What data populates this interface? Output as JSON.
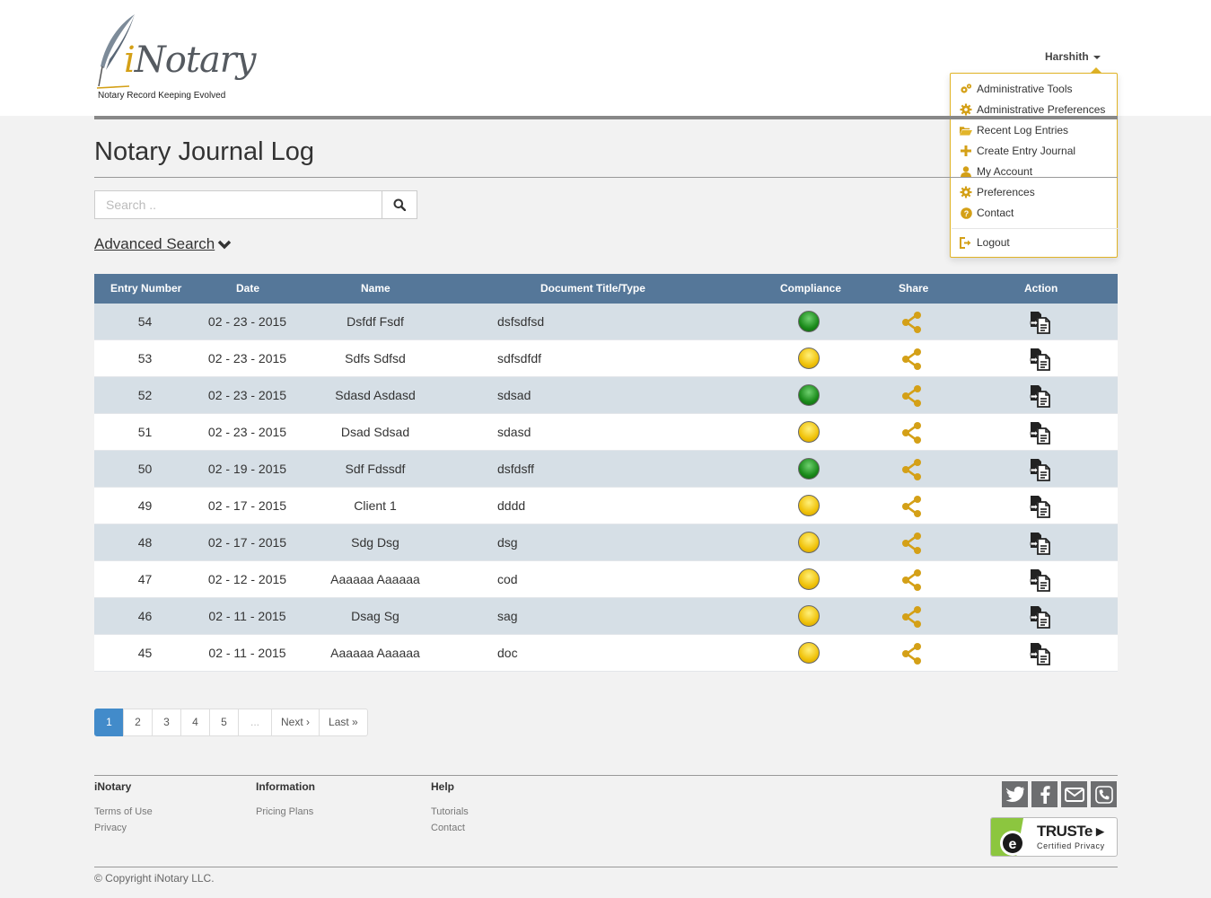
{
  "brand": {
    "name_prefix": "i",
    "name_rest": "Notary",
    "tagline": "Notary Record Keeping Evolved",
    "accent_color": "#d4a017"
  },
  "user_menu": {
    "username": "Harshith",
    "items": [
      {
        "label": "Administrative Tools",
        "icon": "cogs-icon"
      },
      {
        "label": "Administrative Preferences",
        "icon": "gear-icon"
      },
      {
        "label": "Recent Log Entries",
        "icon": "folder-open-icon"
      },
      {
        "label": "Create Entry Journal",
        "icon": "plus-icon"
      },
      {
        "label": "My Account",
        "icon": "user-icon"
      },
      {
        "label": "Preferences",
        "icon": "gear-icon"
      },
      {
        "label": "Contact",
        "icon": "question-circle-icon"
      }
    ],
    "logout_label": "Logout"
  },
  "page": {
    "title": "Notary Journal Log"
  },
  "search": {
    "placeholder": "Search ..",
    "advanced_label": "Advanced Search"
  },
  "table": {
    "header_color": "#557799",
    "columns": [
      "Entry Number",
      "Date",
      "Name",
      "Document Title/Type",
      "Compliance",
      "Share",
      "Action"
    ],
    "rows": [
      {
        "entry": "54",
        "date": "02 - 23 - 2015",
        "name": "Dsfdf Fsdf",
        "doc": "dsfsdfsd",
        "compliance": "green"
      },
      {
        "entry": "53",
        "date": "02 - 23 - 2015",
        "name": "Sdfs Sdfsd",
        "doc": "sdfsdfdf",
        "compliance": "yellow"
      },
      {
        "entry": "52",
        "date": "02 - 23 - 2015",
        "name": "Sdasd Asdasd",
        "doc": "sdsad",
        "compliance": "green"
      },
      {
        "entry": "51",
        "date": "02 - 23 - 2015",
        "name": "Dsad Sdsad",
        "doc": "sdasd",
        "compliance": "yellow"
      },
      {
        "entry": "50",
        "date": "02 - 19 - 2015",
        "name": "Sdf Fdssdf",
        "doc": "dsfdsff",
        "compliance": "green"
      },
      {
        "entry": "49",
        "date": "02 - 17 - 2015",
        "name": "Client 1",
        "doc": "dddd",
        "compliance": "yellow"
      },
      {
        "entry": "48",
        "date": "02 - 17 - 2015",
        "name": "Sdg Dsg",
        "doc": "dsg",
        "compliance": "yellow"
      },
      {
        "entry": "47",
        "date": "02 - 12 - 2015",
        "name": "Aaaaaa Aaaaaa",
        "doc": "cod",
        "compliance": "yellow"
      },
      {
        "entry": "46",
        "date": "02 - 11 - 2015",
        "name": "Dsag Sg",
        "doc": "sag",
        "compliance": "yellow"
      },
      {
        "entry": "45",
        "date": "02 - 11 - 2015",
        "name": "Aaaaaa Aaaaaa",
        "doc": "doc",
        "compliance": "yellow"
      }
    ]
  },
  "pagination": {
    "current": "1",
    "pages": [
      "2",
      "3",
      "4",
      "5"
    ],
    "ellipsis": "...",
    "next_label": "Next ›",
    "last_label": "Last »"
  },
  "footer": {
    "col1": {
      "heading": "iNotary",
      "links": [
        "Terms of Use",
        "Privacy"
      ]
    },
    "col2": {
      "heading": "Information",
      "links": [
        "Pricing Plans"
      ]
    },
    "col3": {
      "heading": "Help",
      "links": [
        "Tutorials",
        "Contact"
      ]
    },
    "social": [
      "twitter-icon",
      "facebook-icon",
      "email-icon",
      "phone-icon"
    ],
    "truste": {
      "title": "TRUSTe",
      "subtitle": "Certified Privacy"
    },
    "copyright": "© Copyright iNotary LLC."
  }
}
